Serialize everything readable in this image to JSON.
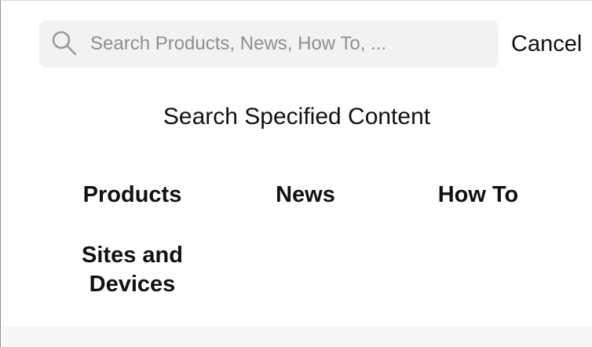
{
  "search": {
    "placeholder": "Search Products, News, How To, ...",
    "icon": "search-icon",
    "cancel_label": "Cancel"
  },
  "section": {
    "title": "Search Specified Content"
  },
  "categories": [
    {
      "label": "Products"
    },
    {
      "label": "News"
    },
    {
      "label": "How To"
    },
    {
      "label": "Sites and\nDevices"
    }
  ],
  "colors": {
    "background": "#ffffff",
    "search_field": "#f2f2f3",
    "placeholder_text": "#8f8f93",
    "primary_text": "#111111",
    "bottom_band": "#f7f7f7"
  }
}
